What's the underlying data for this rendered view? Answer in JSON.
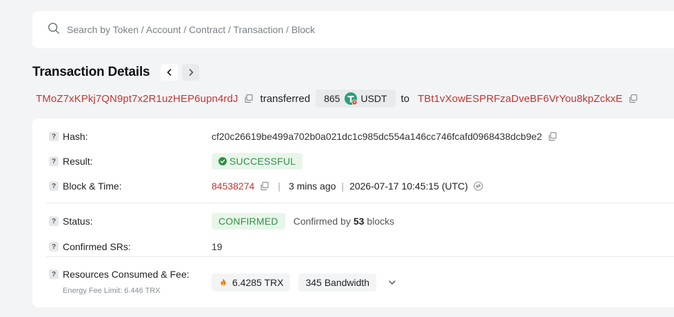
{
  "search": {
    "placeholder": "Search by Token / Account / Contract / Transaction / Block"
  },
  "page": {
    "title": "Transaction Details"
  },
  "transfer": {
    "from_address": "TMoZ7xKPkj7QN9pt7x2R1uzHEP6upn4rdJ",
    "verb": "transferred",
    "amount": "865",
    "token_symbol": "USDT",
    "to_word": "to",
    "to_address": "TBt1vXowESPRFzaDveBF6VrYou8kpZckxE"
  },
  "details": {
    "hash": {
      "label": "Hash:",
      "value": "cf20c26619be499a702b0a021dc1c985dc554a146cc746fcafd0968438dcb9e2"
    },
    "result": {
      "label": "Result:",
      "value": "SUCCESSFUL"
    },
    "block_time": {
      "label": "Block & Time:",
      "block": "84538274",
      "relative": "3 mins ago",
      "timestamp": "2026-07-17 10:45:15 (UTC)"
    },
    "status": {
      "label": "Status:",
      "value": "CONFIRMED",
      "confirmed_prefix": "Confirmed by",
      "confirmed_count": "53",
      "confirmed_suffix": "blocks"
    },
    "confirmed_srs": {
      "label": "Confirmed SRs:",
      "value": "19"
    },
    "resources": {
      "label": "Resources Consumed & Fee:",
      "sublabel": "Energy Fee Limit: 6.446 TRX",
      "fee": "6.4285 TRX",
      "bandwidth": "345 Bandwidth"
    }
  },
  "icons": {
    "search": "search-icon",
    "prev": "chevron-left-icon",
    "next": "chevron-right-icon",
    "copy": "copy-icon",
    "help": "help-icon",
    "check": "check-circle-icon",
    "clock": "clock-convert-icon",
    "fire": "fire-icon",
    "expand": "chevron-down-icon"
  },
  "colors": {
    "link_red": "#c23631",
    "success_green": "#2f8f45",
    "success_bg": "#e8f6ea",
    "tether_green": "#26a17b"
  }
}
